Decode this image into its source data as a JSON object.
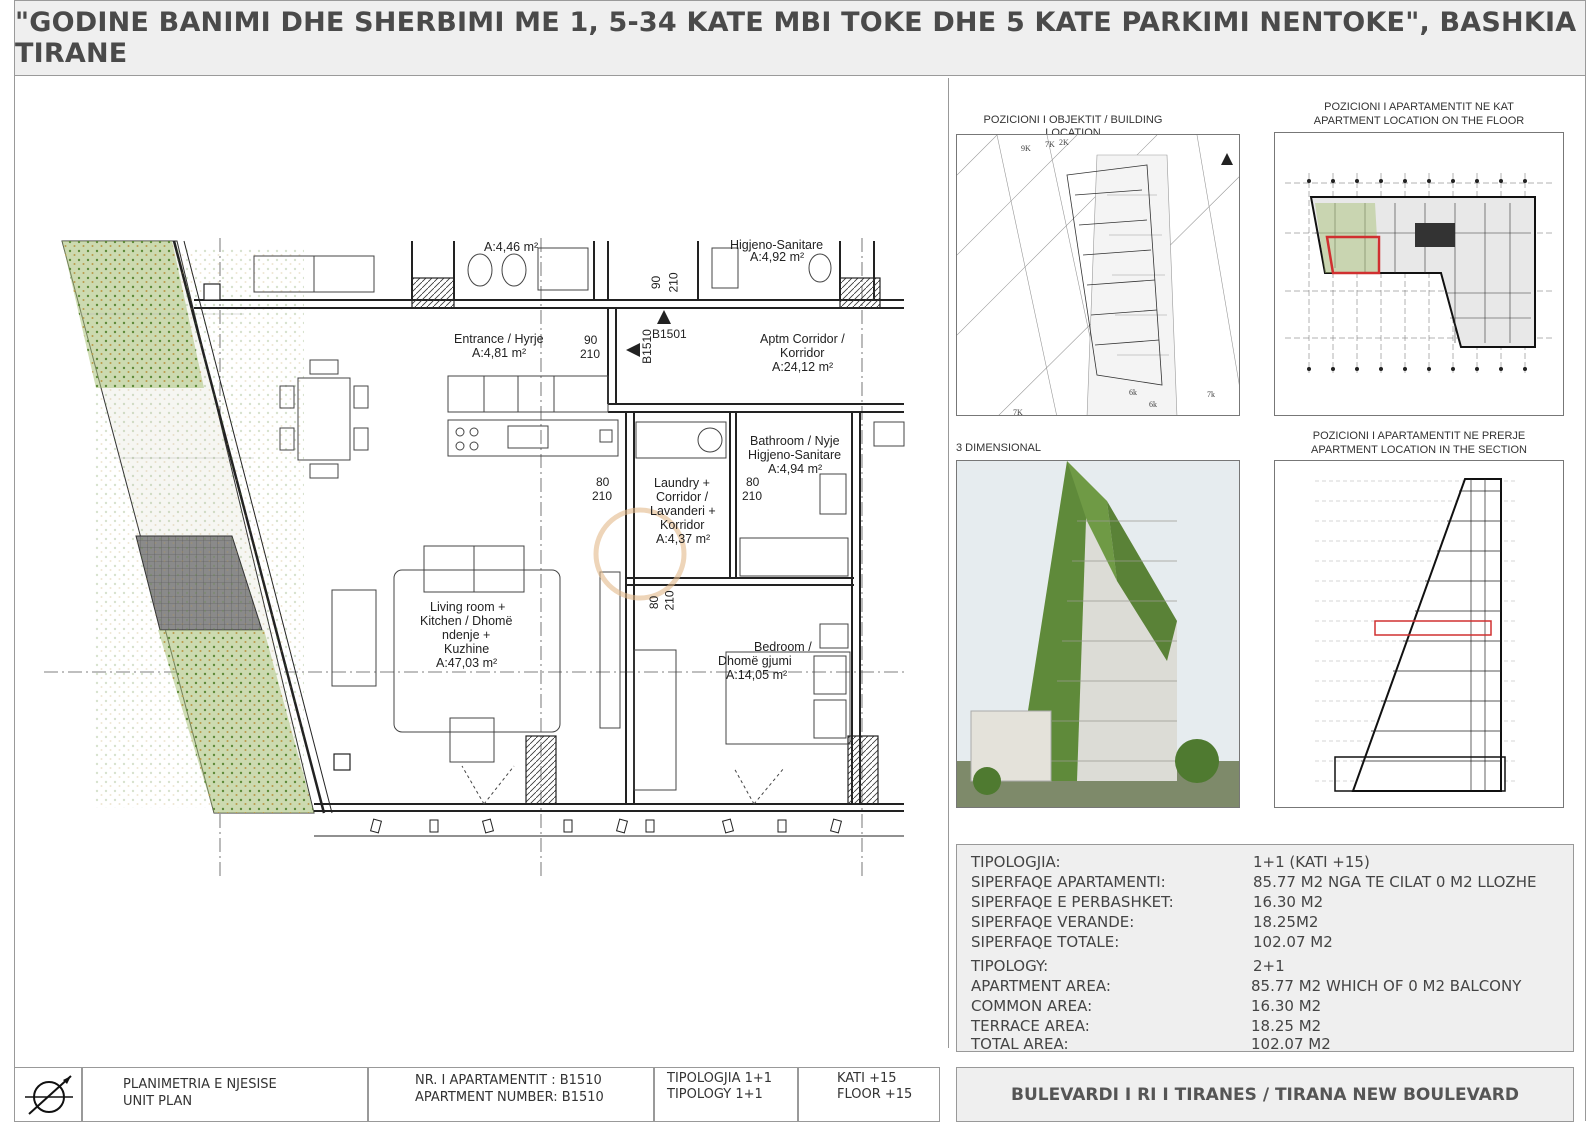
{
  "header": {
    "title": "\"GODINE BANIMI DHE SHERBIMI ME 1, 5-34 KATE MBI TOKE DHE 5 KATE PARKIMI NENTOKE\", BASHKIA TIRANE"
  },
  "plan": {
    "rooms": {
      "top_left_area": "A:4,46 m²",
      "top_right_name": "Higjeno-Sanitare",
      "top_right_area": "A:4,92 m²",
      "entrance_name": "Entrance / Hyrje",
      "entrance_area": "A:4,81 m²",
      "corridor_name_1": "Aptm Corridor /",
      "corridor_name_2": "Korridor",
      "corridor_area": "A:24,12 m²",
      "bathroom_name_1": "Bathroom / Nyje",
      "bathroom_name_2": "Higjeno-Sanitare",
      "bathroom_area": "A:4,94 m²",
      "laundry_1": "Laundry +",
      "laundry_2": "Corridor /",
      "laundry_3": "Lavanderi +",
      "laundry_4": "Korridor",
      "laundry_area": "A:4,37 m²",
      "living_1": "Living room +",
      "living_2": "Kitchen / Dhomë",
      "living_3": "ndenje +",
      "living_4": "Kuzhine",
      "living_area": "A:47,03 m²",
      "bedroom_1": "Bedroom /",
      "bedroom_2": "Dhomë gjumi",
      "bedroom_area": "A:14,05 m²"
    },
    "dims": {
      "d90": "90",
      "d210": "210",
      "d80": "80",
      "unit_tag": "B1501",
      "unit_tag_vertical": "B1510"
    }
  },
  "panels": {
    "building_location": "POZICIONI I OBJEKTIT / BUILDING LOCATION",
    "floor_location_1": "POZICIONI I APARTAMENTIT NE KAT",
    "floor_location_2": "APARTMENT LOCATION  ON THE FLOOR",
    "three_d": "3 DIMENSIONAL",
    "section_location_1": "POZICIONI I APARTAMENTIT NE PRERJE",
    "section_location_2": "APARTMENT LOCATION IN THE SECTION",
    "site_labels": [
      "9K",
      "7K",
      "2K",
      "7K",
      "6k",
      "6k",
      "7k"
    ]
  },
  "info": {
    "al": [
      {
        "label": "TIPOLOGJIA:",
        "value": "1+1 (KATI +15)"
      },
      {
        "label": "SIPERFAQE APARTAMENTI:",
        "value": "85.77 M2 NGA TE CILAT 0 M2 LLOZHE"
      },
      {
        "label": "SIPERFAQE  E  PERBASHKET:",
        "value": "16.30 M2"
      },
      {
        "label": "SIPERFAQE  VERANDE:",
        "value": "18.25M2"
      },
      {
        "label": "SIPERFAQE  TOTALE:",
        "value": "102.07 M2"
      }
    ],
    "en": [
      {
        "label": "TIPOLOGY:",
        "value": "2+1"
      },
      {
        "label": "APARTMENT AREA:",
        "value": "85.77 M2 WHICH OF 0 M2 BALCONY"
      },
      {
        "label": "COMMON AREA:",
        "value": "16.30 M2"
      },
      {
        "label": "TERRACE AREA:",
        "value": "18.25 M2"
      },
      {
        "label": "TOTAL AREA:",
        "value": "102.07 M2"
      }
    ]
  },
  "footer": {
    "plan_1": "PLANIMETRIA E NJESISE",
    "plan_2": "UNIT PLAN",
    "apt_1": "NR. I APARTAMENTIT :  B1510",
    "apt_2": "APARTMENT NUMBER: B1510",
    "typ_1": "TIPOLOGJIA 1+1",
    "typ_2": "TIPOLOGY    1+1",
    "floor_1": "KATI     +15",
    "floor_2": "FLOOR +15",
    "boulevard": "BULEVARDI I RI I TIRANES / TIRANA NEW BOULEVARD"
  },
  "colors": {
    "greenery": "#7fa04a",
    "highlight": "#d03030",
    "header_bg": "#efefef"
  }
}
